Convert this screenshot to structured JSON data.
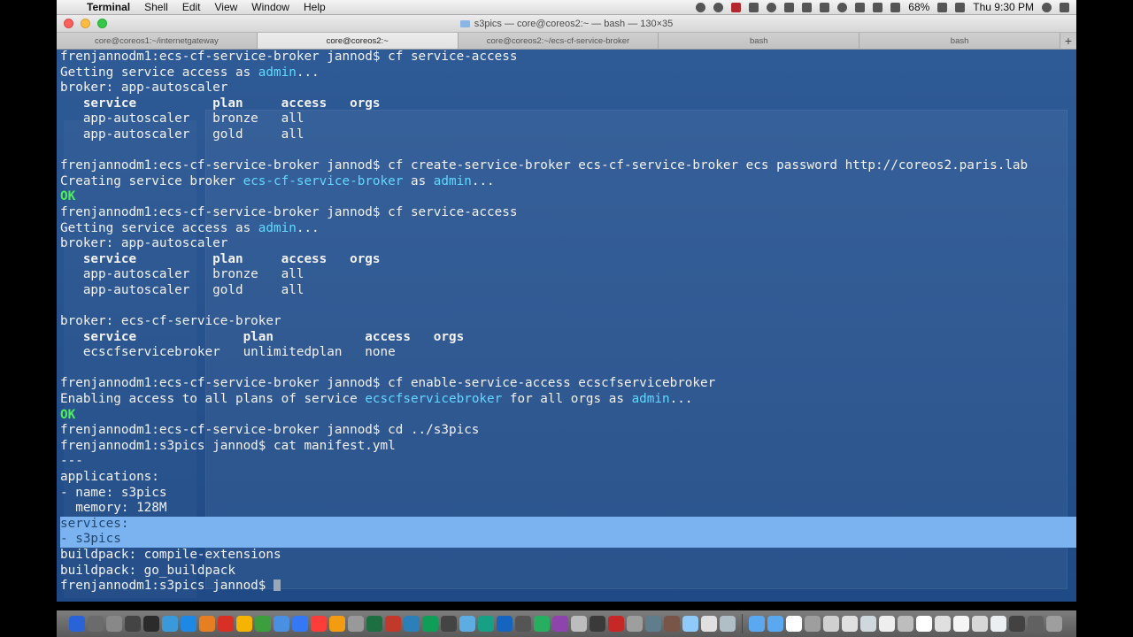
{
  "menubar": {
    "app_name": "Terminal",
    "items": [
      "Shell",
      "Edit",
      "View",
      "Window",
      "Help"
    ],
    "battery": "68%",
    "clock": "Thu 9:30 PM"
  },
  "window": {
    "title": "s3pics — core@coreos2:~ — bash — 130×35"
  },
  "tabs": [
    {
      "label": "core@coreos1:~/internetgateway",
      "active": false
    },
    {
      "label": "core@coreos2:~",
      "active": true
    },
    {
      "label": "core@coreos2:~/ecs-cf-service-broker",
      "active": false
    },
    {
      "label": "bash",
      "active": false
    },
    {
      "label": "bash",
      "active": false
    }
  ],
  "terminal": {
    "lines": [
      {
        "segs": [
          {
            "t": "frenjannodm1:ecs-cf-service-broker jannod$ cf service-access"
          }
        ]
      },
      {
        "segs": [
          {
            "t": "Getting service access as "
          },
          {
            "t": "admin",
            "c": "cyan"
          },
          {
            "t": "..."
          }
        ]
      },
      {
        "segs": [
          {
            "t": "broker: app-autoscaler"
          }
        ]
      },
      {
        "segs": [
          {
            "t": "   service          plan     access   orgs",
            "c": "hdr"
          }
        ]
      },
      {
        "segs": [
          {
            "t": "   app-autoscaler   bronze   all"
          }
        ]
      },
      {
        "segs": [
          {
            "t": "   app-autoscaler   gold     all"
          }
        ]
      },
      {
        "segs": [
          {
            "t": ""
          }
        ]
      },
      {
        "segs": [
          {
            "t": "frenjannodm1:ecs-cf-service-broker jannod$ cf create-service-broker ecs-cf-service-broker ecs password http://coreos2.paris.lab"
          }
        ]
      },
      {
        "segs": [
          {
            "t": "Creating service broker "
          },
          {
            "t": "ecs-cf-service-broker",
            "c": "cyan"
          },
          {
            "t": " as "
          },
          {
            "t": "admin",
            "c": "cyan"
          },
          {
            "t": "..."
          }
        ]
      },
      {
        "segs": [
          {
            "t": "OK",
            "c": "green"
          }
        ]
      },
      {
        "segs": [
          {
            "t": "frenjannodm1:ecs-cf-service-broker jannod$ cf service-access"
          }
        ]
      },
      {
        "segs": [
          {
            "t": "Getting service access as "
          },
          {
            "t": "admin",
            "c": "cyan"
          },
          {
            "t": "..."
          }
        ]
      },
      {
        "segs": [
          {
            "t": "broker: app-autoscaler"
          }
        ]
      },
      {
        "segs": [
          {
            "t": "   service          plan     access   orgs",
            "c": "hdr"
          }
        ]
      },
      {
        "segs": [
          {
            "t": "   app-autoscaler   bronze   all"
          }
        ]
      },
      {
        "segs": [
          {
            "t": "   app-autoscaler   gold     all"
          }
        ]
      },
      {
        "segs": [
          {
            "t": ""
          }
        ]
      },
      {
        "segs": [
          {
            "t": "broker: ecs-cf-service-broker"
          }
        ]
      },
      {
        "segs": [
          {
            "t": "   service              plan            access   orgs",
            "c": "hdr"
          }
        ]
      },
      {
        "segs": [
          {
            "t": "   ecscfservicebroker   unlimitedplan   none"
          }
        ]
      },
      {
        "segs": [
          {
            "t": ""
          }
        ]
      },
      {
        "segs": [
          {
            "t": "frenjannodm1:ecs-cf-service-broker jannod$ cf enable-service-access ecscfservicebroker"
          }
        ]
      },
      {
        "segs": [
          {
            "t": "Enabling access to all plans of service "
          },
          {
            "t": "ecscfservicebroker",
            "c": "cyan"
          },
          {
            "t": " for all orgs as "
          },
          {
            "t": "admin",
            "c": "cyan"
          },
          {
            "t": "..."
          }
        ]
      },
      {
        "segs": [
          {
            "t": "OK",
            "c": "green"
          }
        ]
      },
      {
        "segs": [
          {
            "t": "frenjannodm1:ecs-cf-service-broker jannod$ cd ../s3pics"
          }
        ]
      },
      {
        "segs": [
          {
            "t": "frenjannodm1:s3pics jannod$ cat manifest.yml"
          }
        ]
      },
      {
        "segs": [
          {
            "t": "---"
          }
        ]
      },
      {
        "segs": [
          {
            "t": "applications:"
          }
        ]
      },
      {
        "segs": [
          {
            "t": "- name: s3pics"
          }
        ]
      },
      {
        "segs": [
          {
            "t": "  memory: 128M"
          }
        ]
      },
      {
        "segs": [
          {
            "t": "services:"
          }
        ],
        "selected": true
      },
      {
        "segs": [
          {
            "t": "- s3pics"
          }
        ],
        "selected": true
      },
      {
        "segs": [
          {
            "t": "buildpack: compile-extensions"
          }
        ]
      },
      {
        "segs": [
          {
            "t": "buildpack: go_buildpack"
          }
        ]
      },
      {
        "segs": [
          {
            "t": "frenjannodm1:s3pics jannod$ "
          }
        ],
        "cursor": true
      }
    ]
  },
  "dock": {
    "colors": [
      "#2a62d8",
      "#6b6b6b",
      "#888888",
      "#444444",
      "#2b2b2b",
      "#3a9ad9",
      "#1e88e5",
      "#e67e22",
      "#d93025",
      "#f4b400",
      "#3c9e3c",
      "#4a90e2",
      "#3478f6",
      "#fc3d39",
      "#f39c12",
      "#999999",
      "#1d6f42",
      "#c0392b",
      "#2c7fb8",
      "#0f9d58",
      "#444444",
      "#5dade2",
      "#16a085",
      "#1565c0",
      "#555555",
      "#27ae60",
      "#8e44ad",
      "#bdbdbd",
      "#3a3a3a",
      "#c62828",
      "#9e9e9e",
      "#607d8b",
      "#795548",
      "#90caf9",
      "#e0e0e0",
      "#b0bec5"
    ],
    "right_colors": [
      "#5aa9f0",
      "#5aa9f0",
      "#ffffff",
      "#9e9e9e",
      "#d0d0d0",
      "#e0e0e0",
      "#cfd8dc",
      "#eeeeee",
      "#bdbdbd",
      "#ffffff",
      "#e0e0e0",
      "#f5f5f5",
      "#d7d7d7",
      "#eceff1",
      "#424242",
      "#616161",
      "#9e9e9e"
    ]
  }
}
